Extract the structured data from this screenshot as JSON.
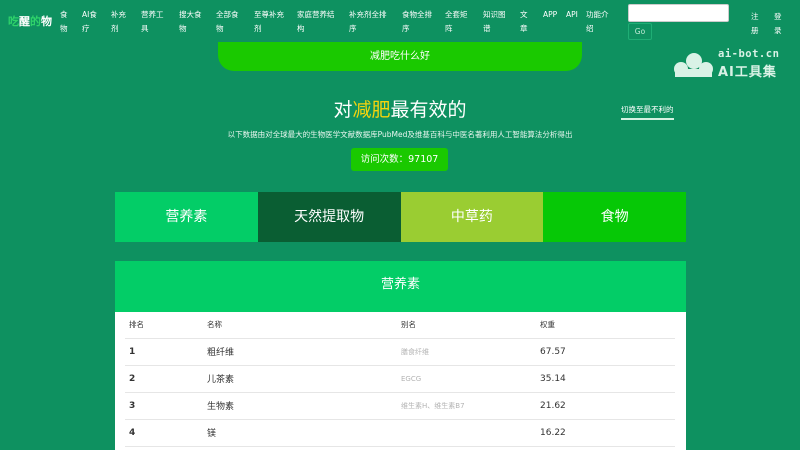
{
  "logo": {
    "part1": "吃",
    "part2": "醒",
    "part3": "的",
    "part4": "物"
  },
  "nav": {
    "items": [
      [
        "食",
        "物"
      ],
      [
        "AI食",
        "疗"
      ],
      [
        "补充",
        "剂"
      ],
      [
        "营养工",
        "具"
      ],
      [
        "搜大食",
        "物"
      ],
      [
        "全部食",
        "物"
      ],
      [
        "至尊补充",
        "剂"
      ],
      [
        "家庭营养结",
        "构"
      ],
      [
        "补充剂全排",
        "序"
      ],
      [
        "食物全排",
        "序"
      ],
      [
        "全套矩",
        "阵"
      ],
      [
        "知识图",
        "谱"
      ],
      [
        "文",
        "章"
      ],
      [
        "APP"
      ],
      [
        "API"
      ],
      [
        "功能介",
        "绍"
      ]
    ],
    "search_placeholder": "",
    "go_label": "Go",
    "register": [
      "注",
      "册"
    ],
    "login": [
      "登",
      "录"
    ]
  },
  "watermark": {
    "domain": "ai-bot.cn",
    "name": "AI工具集"
  },
  "top_pill": "减肥吃什么好",
  "title": {
    "prefix": "对",
    "highlight": "减肥",
    "suffix": "最有效的"
  },
  "switch_link": "切换至最不利的",
  "subtitle": "以下数据由对全球最大的生物医学文献数据库PubMed及维基百科与中医名著利用人工智能算法分析得出",
  "visit_badge": "访问次数：97107",
  "tabs": [
    "营养素",
    "天然提取物",
    "中草药",
    "食物"
  ],
  "panel": {
    "title": "营养素",
    "headers": [
      "排名",
      "名称",
      "别名",
      "权重"
    ],
    "rows": [
      {
        "rank": "1",
        "name": "粗纤维",
        "alias": "膳食纤维",
        "weight": "67.57"
      },
      {
        "rank": "2",
        "name": "儿茶素",
        "alias": "EGCG",
        "weight": "35.14"
      },
      {
        "rank": "3",
        "name": "生物素",
        "alias": "维生素H、维生素B7",
        "weight": "21.62"
      },
      {
        "rank": "4",
        "name": "镁",
        "alias": "",
        "weight": "16.22"
      }
    ]
  },
  "colors": {
    "background": "#0e9160",
    "accent_green": "#1ac900",
    "highlight_yellow": "#f5d40d",
    "tab_nutrient": "#03cd67",
    "tab_extract": "#0a5e33",
    "tab_herb": "#9acd32",
    "tab_food": "#06c806"
  }
}
